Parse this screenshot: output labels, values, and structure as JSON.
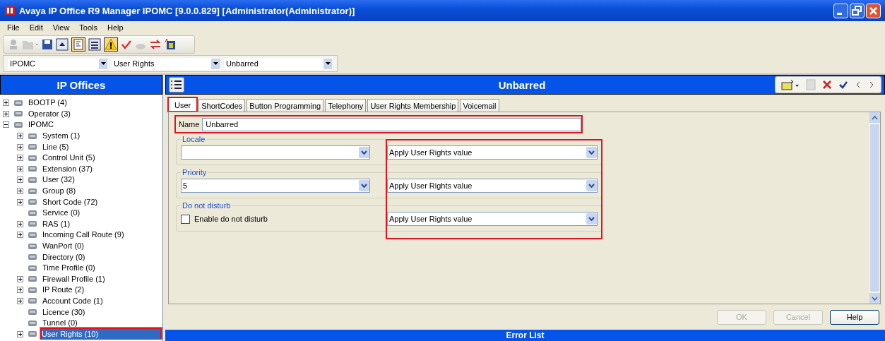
{
  "window": {
    "title": "Avaya IP Office R9 Manager IPOMC [9.0.0.829] [Administrator(Administrator)]"
  },
  "menu": [
    "File",
    "Edit",
    "View",
    "Tools",
    "Help"
  ],
  "selectors": [
    {
      "value": "IPOMC"
    },
    {
      "value": "User Rights"
    },
    {
      "value": "Unbarred"
    }
  ],
  "sidebar": {
    "title": "IP Offices",
    "tree": [
      {
        "label": "BOOTP (4)",
        "kind": "branch",
        "expanded": false,
        "highlighted": false,
        "selected": false
      },
      {
        "label": "Operator (3)",
        "kind": "branch",
        "expanded": false,
        "highlighted": false,
        "selected": false
      },
      {
        "label": "IPOMC",
        "kind": "branch",
        "expanded": true,
        "highlighted": false,
        "selected": false,
        "children": [
          {
            "label": "System (1)",
            "kind": "branch",
            "expanded": false,
            "highlighted": false,
            "selected": false
          },
          {
            "label": "Line (5)",
            "kind": "branch",
            "expanded": false,
            "highlighted": false,
            "selected": false
          },
          {
            "label": "Control Unit (5)",
            "kind": "branch",
            "expanded": false,
            "highlighted": false,
            "selected": false
          },
          {
            "label": "Extension (37)",
            "kind": "branch",
            "expanded": false,
            "highlighted": false,
            "selected": false
          },
          {
            "label": "User (32)",
            "kind": "branch",
            "expanded": false,
            "highlighted": false,
            "selected": false
          },
          {
            "label": "Group (8)",
            "kind": "branch",
            "expanded": false,
            "highlighted": false,
            "selected": false
          },
          {
            "label": "Short Code (72)",
            "kind": "branch",
            "expanded": false,
            "highlighted": false,
            "selected": false
          },
          {
            "label": "Service (0)",
            "kind": "leaf",
            "highlighted": false,
            "selected": false
          },
          {
            "label": "RAS (1)",
            "kind": "branch",
            "expanded": false,
            "highlighted": false,
            "selected": false
          },
          {
            "label": "Incoming Call Route (9)",
            "kind": "branch",
            "expanded": false,
            "highlighted": false,
            "selected": false
          },
          {
            "label": "WanPort (0)",
            "kind": "leaf",
            "highlighted": false,
            "selected": false
          },
          {
            "label": "Directory (0)",
            "kind": "leaf",
            "highlighted": false,
            "selected": false
          },
          {
            "label": "Time Profile (0)",
            "kind": "leaf",
            "highlighted": false,
            "selected": false
          },
          {
            "label": "Firewall Profile (1)",
            "kind": "branch",
            "expanded": false,
            "highlighted": false,
            "selected": false
          },
          {
            "label": "IP Route (2)",
            "kind": "branch",
            "expanded": false,
            "highlighted": false,
            "selected": false
          },
          {
            "label": "Account Code (1)",
            "kind": "branch",
            "expanded": false,
            "highlighted": false,
            "selected": false
          },
          {
            "label": "Licence (30)",
            "kind": "leaf",
            "highlighted": false,
            "selected": false
          },
          {
            "label": "Tunnel (0)",
            "kind": "leaf",
            "highlighted": false,
            "selected": false
          },
          {
            "label": "User Rights (10)",
            "kind": "branch",
            "expanded": false,
            "highlighted": true,
            "selected": true
          }
        ]
      }
    ]
  },
  "editor": {
    "title": "Unbarred",
    "tabs": [
      {
        "label": "User",
        "selected": true,
        "highlighted": true
      },
      {
        "label": "ShortCodes",
        "selected": false,
        "highlighted": false
      },
      {
        "label": "Button Programming",
        "selected": false,
        "highlighted": false
      },
      {
        "label": "Telephony",
        "selected": false,
        "highlighted": false
      },
      {
        "label": "User Rights Membership",
        "selected": false,
        "highlighted": false
      },
      {
        "label": "Voicemail",
        "selected": false,
        "highlighted": false
      }
    ],
    "name": {
      "label": "Name",
      "value": "Unbarred",
      "highlighted": true
    },
    "groups": [
      {
        "title": "Locale",
        "kind": "select",
        "override": "Apply User Rights value"
      },
      {
        "title": "Priority",
        "kind": "select",
        "value": "5",
        "override": "Apply User Rights value"
      },
      {
        "title": "Do not disturb",
        "kind": "checkbox",
        "label": "Enable do not disturb",
        "checked": false,
        "override": "Apply User Rights value"
      }
    ],
    "overrides_highlighted": true,
    "buttons": [
      {
        "label": "OK",
        "disabled": true
      },
      {
        "label": "Cancel",
        "disabled": true
      },
      {
        "label": "Help",
        "disabled": false
      }
    ]
  },
  "error_panel": {
    "title": "Error List"
  }
}
